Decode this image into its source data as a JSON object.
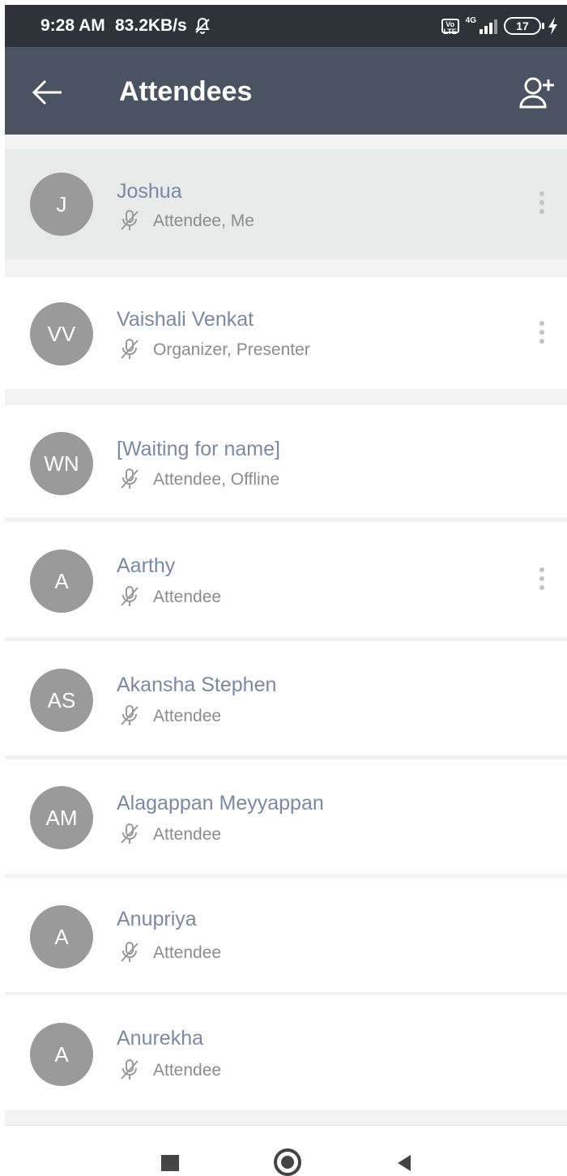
{
  "status_bar": {
    "time": "9:28 AM",
    "network_speed": "83.2KB/s",
    "volte": "Vo LTE",
    "network_type": "4G",
    "battery": "17"
  },
  "header": {
    "title": "Attendees",
    "back_icon": "arrow-left-icon",
    "add_icon": "add-person-icon"
  },
  "attendees": [
    {
      "initials": "J",
      "name": "Joshua",
      "role": "Attendee, Me",
      "has_menu": true,
      "selected": true
    },
    {
      "initials": "VV",
      "name": "Vaishali Venkat",
      "role": "Organizer, Presenter",
      "has_menu": true
    },
    {
      "initials": "WN",
      "name": "[Waiting for name]",
      "role": "Attendee, Offline",
      "has_menu": false
    },
    {
      "initials": "A",
      "name": "Aarthy",
      "role": "Attendee",
      "has_menu": true
    },
    {
      "initials": "AS",
      "name": "Akansha Stephen",
      "role": "Attendee",
      "has_menu": false
    },
    {
      "initials": "AM",
      "name": "Alagappan Meyyappan",
      "role": "Attendee",
      "has_menu": false
    },
    {
      "initials": "A",
      "name": "Anupriya",
      "role": "Attendee",
      "has_menu": false
    },
    {
      "initials": "A",
      "name": "Anurekha",
      "role": "Attendee",
      "has_menu": false
    }
  ],
  "colors": {
    "app_bar": "#4b5261",
    "status_bar": "#2d3339",
    "avatar": "#9a9a9a",
    "name_text": "#7b88a6",
    "role_text": "#8c8c8c",
    "selected_row": "#e9eaea"
  }
}
